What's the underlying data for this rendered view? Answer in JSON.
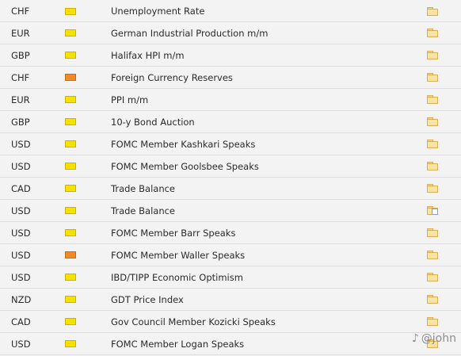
{
  "rows": [
    {
      "currency": "CHF",
      "impact": "medium",
      "event": "Unemployment Rate",
      "detail": "folder"
    },
    {
      "currency": "EUR",
      "impact": "medium",
      "event": "German Industrial Production m/m",
      "detail": "folder"
    },
    {
      "currency": "GBP",
      "impact": "medium",
      "event": "Halifax HPI m/m",
      "detail": "folder"
    },
    {
      "currency": "CHF",
      "impact": "high",
      "event": "Foreign Currency Reserves",
      "detail": "folder"
    },
    {
      "currency": "EUR",
      "impact": "medium",
      "event": "PPI m/m",
      "detail": "folder"
    },
    {
      "currency": "GBP",
      "impact": "medium",
      "event": "10-y Bond Auction",
      "detail": "folder"
    },
    {
      "currency": "USD",
      "impact": "medium",
      "event": "FOMC Member Kashkari Speaks",
      "detail": "folder"
    },
    {
      "currency": "USD",
      "impact": "medium",
      "event": "FOMC Member Goolsbee Speaks",
      "detail": "folder"
    },
    {
      "currency": "CAD",
      "impact": "medium",
      "event": "Trade Balance",
      "detail": "folder"
    },
    {
      "currency": "USD",
      "impact": "medium",
      "event": "Trade Balance",
      "detail": "folder-with-doc"
    },
    {
      "currency": "USD",
      "impact": "medium",
      "event": "FOMC Member Barr Speaks",
      "detail": "folder"
    },
    {
      "currency": "USD",
      "impact": "high",
      "event": "FOMC Member Waller Speaks",
      "detail": "folder"
    },
    {
      "currency": "USD",
      "impact": "medium",
      "event": "IBD/TIPP Economic Optimism",
      "detail": "folder"
    },
    {
      "currency": "NZD",
      "impact": "medium",
      "event": "GDT Price Index",
      "detail": "folder"
    },
    {
      "currency": "CAD",
      "impact": "medium",
      "event": "Gov Council Member Kozicki Speaks",
      "detail": "folder"
    },
    {
      "currency": "USD",
      "impact": "medium",
      "event": "FOMC Member Logan Speaks",
      "detail": "folder"
    }
  ],
  "colors": {
    "impact_medium": "#f5e000",
    "impact_high": "#ef8a27",
    "folder": "#f8e3a5"
  },
  "watermark": {
    "icon": "social-handle-icon",
    "text": "@john"
  }
}
